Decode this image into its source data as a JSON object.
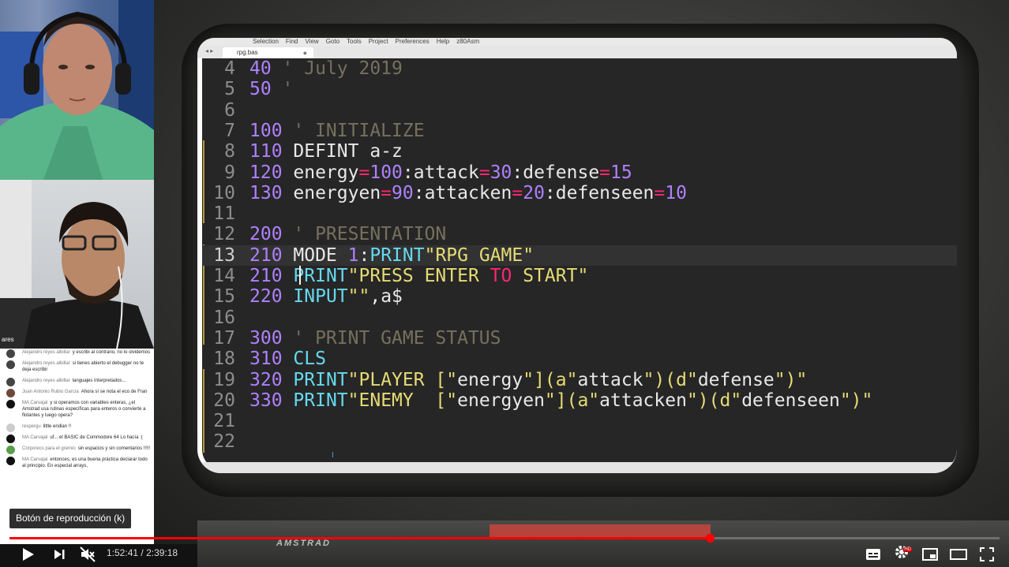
{
  "editor": {
    "menu": [
      "Selection",
      "Find",
      "View",
      "Goto",
      "Tools",
      "Project",
      "Preferences",
      "Help",
      "z80Asm"
    ],
    "tab_name": "rpg.bas",
    "lines": [
      {
        "n": "4",
        "code": [
          {
            "t": "40",
            "c": "num"
          },
          {
            "t": " ' July 2019",
            "c": "cm"
          }
        ]
      },
      {
        "n": "5",
        "code": [
          {
            "t": "50",
            "c": "num"
          },
          {
            "t": " '",
            "c": "cm"
          }
        ]
      },
      {
        "n": "6",
        "code": []
      },
      {
        "n": "7",
        "code": [
          {
            "t": "100",
            "c": "num"
          },
          {
            "t": " ' INITIALIZE",
            "c": "cm"
          }
        ]
      },
      {
        "n": "8",
        "code": [
          {
            "t": "110",
            "c": "num"
          },
          {
            "t": " DEFINT a-z",
            "c": ""
          }
        ]
      },
      {
        "n": "9",
        "code": [
          {
            "t": "120",
            "c": "num"
          },
          {
            "t": " energy",
            "c": ""
          },
          {
            "t": "=",
            "c": "op"
          },
          {
            "t": "100",
            "c": "num"
          },
          {
            "t": ":attack",
            "c": ""
          },
          {
            "t": "=",
            "c": "op"
          },
          {
            "t": "30",
            "c": "num"
          },
          {
            "t": ":defense",
            "c": ""
          },
          {
            "t": "=",
            "c": "op"
          },
          {
            "t": "15",
            "c": "num"
          }
        ]
      },
      {
        "n": "10",
        "code": [
          {
            "t": "130",
            "c": "num"
          },
          {
            "t": " energyen",
            "c": ""
          },
          {
            "t": "=",
            "c": "op"
          },
          {
            "t": "90",
            "c": "num"
          },
          {
            "t": ":attacken",
            "c": ""
          },
          {
            "t": "=",
            "c": "op"
          },
          {
            "t": "20",
            "c": "num"
          },
          {
            "t": ":defenseen",
            "c": ""
          },
          {
            "t": "=",
            "c": "op"
          },
          {
            "t": "10",
            "c": "num"
          }
        ]
      },
      {
        "n": "11",
        "code": []
      },
      {
        "n": "12",
        "code": [
          {
            "t": "200",
            "c": "num"
          },
          {
            "t": " ' PRESENTATION",
            "c": "cm"
          }
        ]
      },
      {
        "n": "13",
        "code": [
          {
            "t": "210",
            "c": "num"
          },
          {
            "t": " MODE ",
            "c": ""
          },
          {
            "t": "1",
            "c": "num"
          },
          {
            "t": ":",
            "c": ""
          },
          {
            "t": "PRINT",
            "c": "kw"
          },
          {
            "t": "\"RPG GAME\"",
            "c": "str"
          }
        ]
      },
      {
        "n": "14",
        "code": [
          {
            "t": "210",
            "c": "num"
          },
          {
            "t": " ",
            "c": ""
          },
          {
            "t": "PRINT",
            "c": "kw"
          },
          {
            "t": "\"PRESS ENTER ",
            "c": "str"
          },
          {
            "t": "TO",
            "c": "op"
          },
          {
            "t": " START\"",
            "c": "str"
          }
        ]
      },
      {
        "n": "15",
        "code": [
          {
            "t": "220",
            "c": "num"
          },
          {
            "t": " ",
            "c": ""
          },
          {
            "t": "INPUT",
            "c": "kw"
          },
          {
            "t": "\"\"",
            "c": "str"
          },
          {
            "t": ",a$",
            "c": ""
          }
        ]
      },
      {
        "n": "16",
        "code": []
      },
      {
        "n": "17",
        "code": [
          {
            "t": "300",
            "c": "num"
          },
          {
            "t": " ' PRINT GAME STATUS",
            "c": "cm"
          }
        ]
      },
      {
        "n": "18",
        "code": [
          {
            "t": "310",
            "c": "num"
          },
          {
            "t": " ",
            "c": ""
          },
          {
            "t": "CLS",
            "c": "kw"
          }
        ]
      },
      {
        "n": "19",
        "code": [
          {
            "t": "320",
            "c": "num"
          },
          {
            "t": " ",
            "c": ""
          },
          {
            "t": "PRINT",
            "c": "kw"
          },
          {
            "t": "\"PLAYER [\"",
            "c": "str"
          },
          {
            "t": "energy",
            "c": ""
          },
          {
            "t": "\"](a\"",
            "c": "str"
          },
          {
            "t": "attack",
            "c": ""
          },
          {
            "t": "\")(d\"",
            "c": "str"
          },
          {
            "t": "defense",
            "c": ""
          },
          {
            "t": "\")\"",
            "c": "str"
          }
        ]
      },
      {
        "n": "20",
        "code": [
          {
            "t": "330",
            "c": "num"
          },
          {
            "t": " ",
            "c": ""
          },
          {
            "t": "PRINT",
            "c": "kw"
          },
          {
            "t": "\"ENEMY  [\"",
            "c": "str"
          },
          {
            "t": "energyen",
            "c": ""
          },
          {
            "t": "\"](a\"",
            "c": "str"
          },
          {
            "t": "attacken",
            "c": ""
          },
          {
            "t": "\")(d\"",
            "c": "str"
          },
          {
            "t": "defenseen",
            "c": ""
          },
          {
            "t": "\")\"",
            "c": "str"
          }
        ]
      },
      {
        "n": "21",
        "code": []
      },
      {
        "n": "22",
        "code": []
      }
    ],
    "current_line": "13"
  },
  "keyboard": {
    "brand": "AMSTRAD"
  },
  "webcam": {
    "cam2_label": "ares"
  },
  "chat": [
    {
      "author": "Alejandro reyes albillar",
      "text": "y escribi al contrario, no lo olvidemos",
      "avatar": "#444"
    },
    {
      "author": "Alejandro reyes albillar",
      "text": "si tienes abierto el debugger no te deja escribir",
      "avatar": "#444"
    },
    {
      "author": "Alejandro reyes albillar",
      "text": "languajes Interpretados...",
      "avatar": "#444"
    },
    {
      "author": "Juan Antonio Rubio García",
      "text": "Ahora sí se nota el eco de Fran",
      "avatar": "#6b4a3a"
    },
    {
      "author": "MA Carvajal",
      "text": "y si operamos con variables enteras, ¿el Amstrad usa rutinas específicas para enteros o convierte a flotantes y luego opera?",
      "avatar": "#111"
    },
    {
      "author": "respergu",
      "text": "little endian !!",
      "avatar": "#ccc"
    },
    {
      "author": "MA Carvajal",
      "text": "uf... el BASIC de Commodore 64 Lo hacía :(",
      "avatar": "#111"
    },
    {
      "author": "Corporecs para el gremio",
      "text": "sin espacios y sin comentarios !!!!!",
      "avatar": "#5aa04a"
    },
    {
      "author": "MA Carvajal",
      "text": "entonces, es una buena práctica declarar todo al principio. En especial arrays,",
      "avatar": "#111"
    }
  ],
  "player": {
    "tooltip": "Botón de reproducción (k)",
    "current_time": "1:52:41",
    "separator": " / ",
    "duration": "2:39:18",
    "progress": 0.707,
    "hd_badge": "HD",
    "icons": [
      "play-icon",
      "next-icon",
      "mute-icon",
      "subtitles-icon",
      "settings-icon",
      "miniplayer-icon",
      "theater-icon",
      "fullscreen-icon"
    ]
  }
}
